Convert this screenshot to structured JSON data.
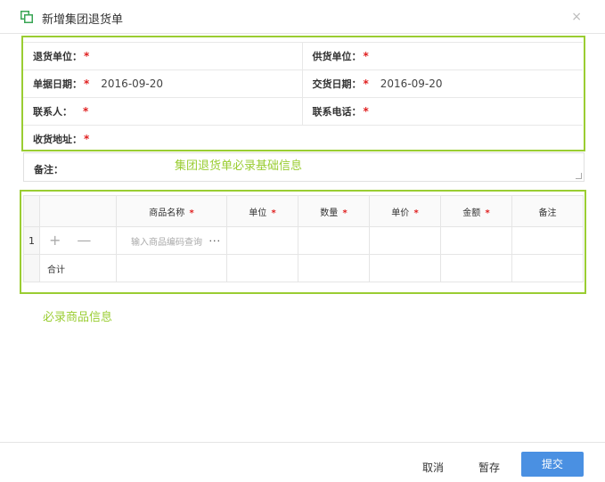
{
  "dialog": {
    "title": "新增集团退货单",
    "close_glyph": "×"
  },
  "form": {
    "return_unit_label": "退货单位：",
    "supply_unit_label": "供货单位：",
    "doc_date_label": "单据日期：",
    "doc_date_value": "2016-09-20",
    "delivery_date_label": "交货日期：",
    "delivery_date_value": "2016-09-20",
    "contact_label": "联系人：",
    "phone_label": "联系电话：",
    "address_label": "收货地址：",
    "remark_label": "备注：",
    "required_mark": "*"
  },
  "annotations": {
    "basic_info": "集团退货单必录基础信息",
    "goods_info": "必录商品信息"
  },
  "grid": {
    "columns": [
      "商品名称",
      "单位",
      "数量",
      "单价",
      "金额",
      "备注"
    ],
    "required_mark": "*",
    "rows": [
      {
        "row_number": "1",
        "add_glyph": "+",
        "remove_glyph": "—",
        "goods_placeholder": "输入商品编码查询",
        "more_glyph": "···"
      }
    ],
    "total_label": "合计"
  },
  "footer": {
    "cancel_label": "取消",
    "save_draft_label": "暂存",
    "submit_label": "提交"
  },
  "colors": {
    "accent_green": "#9acd32",
    "required_red": "#e02020",
    "primary_blue": "#4a90e2"
  }
}
